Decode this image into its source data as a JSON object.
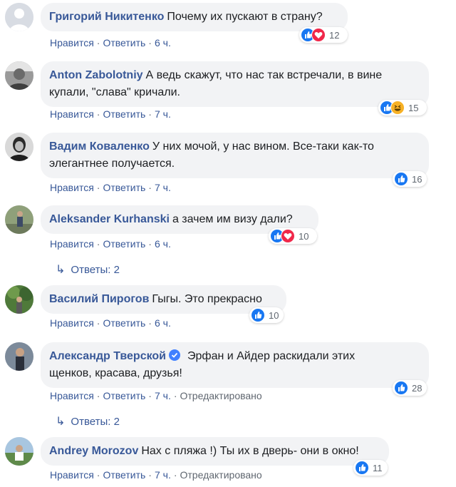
{
  "labels": {
    "like": "Нравится",
    "reply": "Ответить",
    "edited": "Отредактировано",
    "dot": "·"
  },
  "comments": [
    {
      "author": "Григорий Никитенко",
      "text": "Почему их пускают в страну?",
      "time": "6 ч.",
      "reactions": [
        "like",
        "love"
      ],
      "count": "12"
    },
    {
      "author": "Anton Zabolotniy",
      "text": "А ведь скажут, что нас так встречали, в вине",
      "text2": "купали, \"слава\" кричали.",
      "time": "7 ч.",
      "reactions": [
        "like",
        "haha"
      ],
      "count": "15"
    },
    {
      "author": "Вадим Коваленко",
      "text": "У них мочой, у нас вином. Все-таки как-то",
      "text2": "элегантнее получается.",
      "time": "7 ч.",
      "reactions": [
        "like"
      ],
      "count": "16"
    },
    {
      "author": "Aleksander Kurhanski",
      "text": "а зачем им визу дали?",
      "time": "6 ч.",
      "reactions": [
        "like",
        "love"
      ],
      "count": "10",
      "replies": "Ответы: 2"
    },
    {
      "author": "Василий Пирогов",
      "text": "Гыгы. Это прекрасно",
      "time": "6 ч.",
      "reactions": [
        "like"
      ],
      "count": "10"
    },
    {
      "author": "Александр Тверской",
      "verified": true,
      "text": "Эрфан и Айдер раскидали этих",
      "text2": "щенков, красава, друзья!",
      "time": "7 ч.",
      "edited": true,
      "reactions": [
        "like"
      ],
      "count": "28",
      "replies": "Ответы: 2"
    },
    {
      "author": "Andrey Morozov",
      "text": "Нах с пляжа !) Ты их в дверь- они в окно!",
      "time": "7 ч.",
      "edited": true,
      "reactions": [
        "like"
      ],
      "count": "11"
    }
  ]
}
